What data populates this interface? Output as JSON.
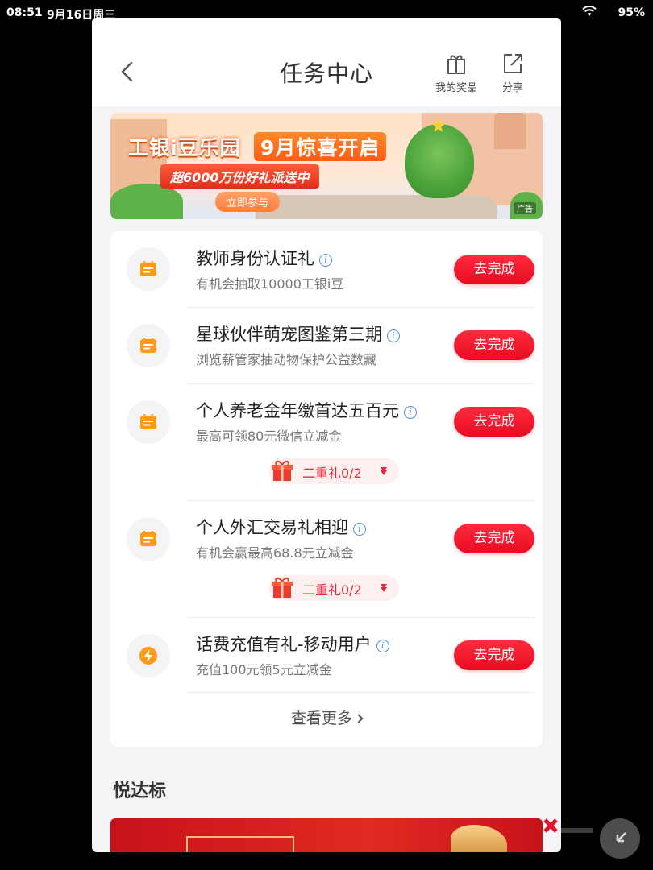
{
  "status_bar": {
    "time": "08:51",
    "date": "9月16日周三",
    "battery": "95%"
  },
  "header": {
    "title": "任务中心",
    "prizes_label": "我的奖品",
    "share_label": "分享"
  },
  "banner": {
    "title": "工银i豆乐园",
    "month": "9月惊喜开启",
    "subtitle": "超6000万份好礼派送中",
    "cta": "立即参与",
    "ad_tag": "广告"
  },
  "tasks": [
    {
      "title": "教师身份认证礼",
      "desc": "有机会抽取10000工银i豆",
      "button": "去完成",
      "icon": "calendar-icon"
    },
    {
      "title": "星球伙伴萌宠图鉴第三期",
      "desc": "浏览薪管家抽动物保护公益数藏",
      "button": "去完成",
      "icon": "calendar-icon"
    },
    {
      "title": "个人养老金年缴首达五百元",
      "desc": "最高可领80元微信立减金",
      "button": "去完成",
      "icon": "calendar-icon",
      "bonus": "二重礼0/2"
    },
    {
      "title": "个人外汇交易礼相迎",
      "desc": "有机会赢最高68.8元立减金",
      "button": "去完成",
      "icon": "calendar-icon",
      "bonus": "二重礼0/2"
    },
    {
      "title": "话费充值有礼-移动用户",
      "desc": "充值100元领5元立减金",
      "button": "去完成",
      "icon": "lightning-icon"
    }
  ],
  "more_label": "查看更多",
  "section": {
    "title": "悦达标"
  },
  "colors": {
    "accent": "#e60c22",
    "icon_orange": "#ff9a16",
    "info_blue": "#4b8fd8"
  }
}
